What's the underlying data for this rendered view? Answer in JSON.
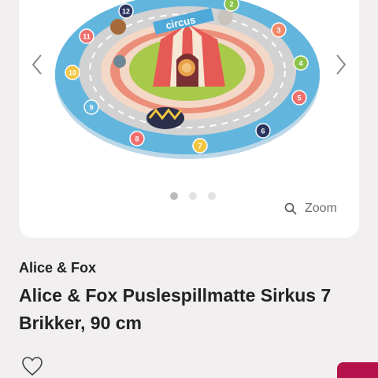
{
  "gallery": {
    "image_alt": "Alice & Fox Puslespillmatte Sirkus",
    "image_text": "circus",
    "board_numbers": [
      "12",
      "2",
      "3",
      "4",
      "5",
      "6",
      "7",
      "8",
      "9",
      "10",
      "11"
    ],
    "dots": [
      {
        "active": true
      },
      {
        "active": false
      },
      {
        "active": false
      }
    ],
    "zoom_label": "Zoom"
  },
  "product": {
    "brand": "Alice & Fox",
    "title": "Alice & Fox Puslespillmatte Sirkus 7 Brikker, 90 cm"
  },
  "colors": {
    "background": "#f1efef",
    "card": "#ffffff",
    "accent": "#b3124a",
    "text": "#222222"
  }
}
